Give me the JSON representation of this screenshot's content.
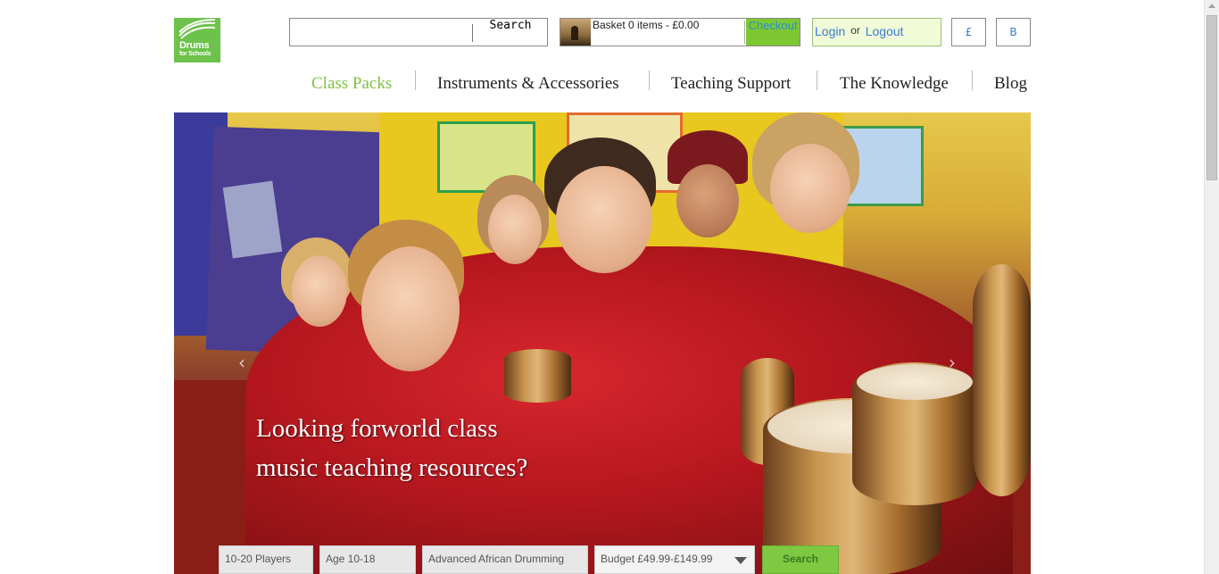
{
  "logo": {
    "line1": "Drums",
    "line2": "for Schools"
  },
  "search": {
    "value": "",
    "button_label": "Search"
  },
  "basket": {
    "label": "Basket 0 items - £0.00",
    "checkout_label": "Checkout"
  },
  "account": {
    "login_label": "Login",
    "or_label": "or",
    "logout_label": "Logout"
  },
  "currency": {
    "gbp_label": "£",
    "b_label": "B"
  },
  "nav": {
    "items": [
      {
        "label": "Class Packs"
      },
      {
        "label": "Instruments & Accessories"
      },
      {
        "label": "Teaching Support"
      },
      {
        "label": "The Knowledge"
      },
      {
        "label": "Blog"
      }
    ]
  },
  "hero": {
    "caption_line1": "Looking forworld class",
    "caption_line2": "music teaching resources?",
    "prev_icon": "‹",
    "next_icon": "›"
  },
  "filters": {
    "players": "10-20 Players",
    "age": "Age 10-18",
    "style": "Advanced African Drumming",
    "budget": "Budget £49.99-£149.99",
    "search_label": "Search"
  },
  "colors": {
    "brand_green": "#6cc24a",
    "nav_active": "#7dc240",
    "checkout_bg": "#7dc832",
    "link_blue": "#3a7bd5"
  }
}
